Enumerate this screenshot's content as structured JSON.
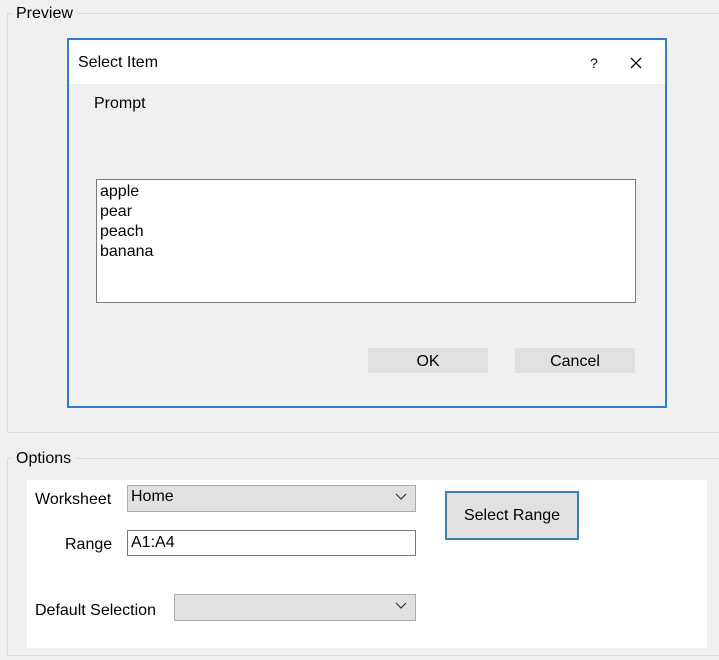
{
  "preview": {
    "group_title": "Preview",
    "dialog": {
      "title": "Select Item",
      "help_label": "?",
      "prompt": "Prompt",
      "items": [
        "apple",
        "pear",
        "peach",
        "banana"
      ],
      "ok_label": "OK",
      "cancel_label": "Cancel"
    }
  },
  "options": {
    "group_title": "Options",
    "worksheet_label": "Worksheet",
    "worksheet_value": "Home",
    "range_label": "Range",
    "range_value": "A1:A4",
    "select_range_label": "Select Range",
    "default_selection_label": "Default Selection",
    "default_selection_value": ""
  },
  "colors": {
    "dialog_border": "#2e7bcf",
    "window_bg": "#f0f0f0",
    "button_bg": "#e1e1e1",
    "select_range_border": "#3c7fb1"
  },
  "icons": {
    "close": "close-icon",
    "dropdown": "chevron-down-icon"
  }
}
